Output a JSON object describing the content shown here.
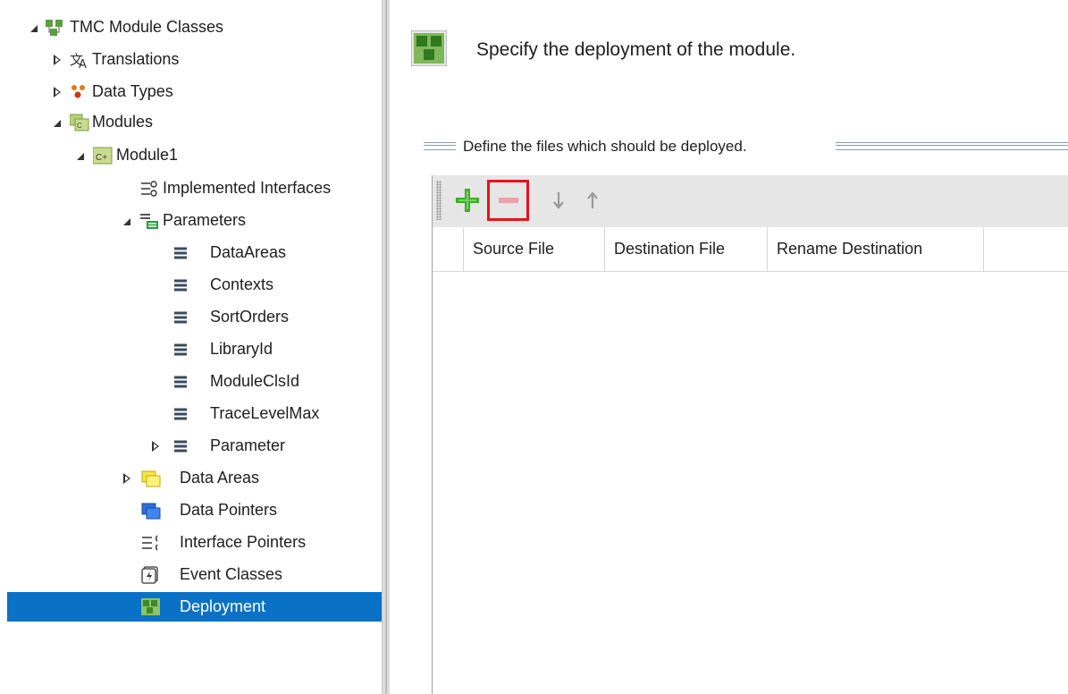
{
  "tree": {
    "root": {
      "label": "TMC Module Classes"
    },
    "translations": {
      "label": "Translations"
    },
    "data_types": {
      "label": "Data Types"
    },
    "modules": {
      "label": "Modules"
    },
    "module1": {
      "label": "Module1"
    },
    "implemented_interfaces": {
      "label": "Implemented Interfaces"
    },
    "parameters": {
      "label": "Parameters"
    },
    "parameter_items": [
      "DataAreas",
      "Contexts",
      "SortOrders",
      "LibraryId",
      "ModuleClsId",
      "TraceLevelMax",
      "Parameter"
    ],
    "data_areas": {
      "label": "Data Areas"
    },
    "data_pointers": {
      "label": "Data Pointers"
    },
    "interface_pointers": {
      "label": "Interface Pointers"
    },
    "event_classes": {
      "label": "Event Classes"
    },
    "deployment": {
      "label": "Deployment",
      "selected": true
    }
  },
  "content": {
    "heading": "Specify the deployment of the module.",
    "group_title": "Define the files which should be deployed.",
    "toolbar": {
      "add": {
        "icon": "plus-icon"
      },
      "remove": {
        "icon": "minus-icon",
        "highlighted": true
      },
      "move_down": {
        "icon": "arrow-down-icon"
      },
      "move_up": {
        "icon": "arrow-up-icon"
      }
    },
    "grid": {
      "columns": [
        "Source File",
        "Destination File",
        "Rename Destination"
      ],
      "rows": []
    }
  },
  "colors": {
    "selection": "#0a72c6",
    "highlight": "#e8121b",
    "add_icon": "#3fae29"
  }
}
